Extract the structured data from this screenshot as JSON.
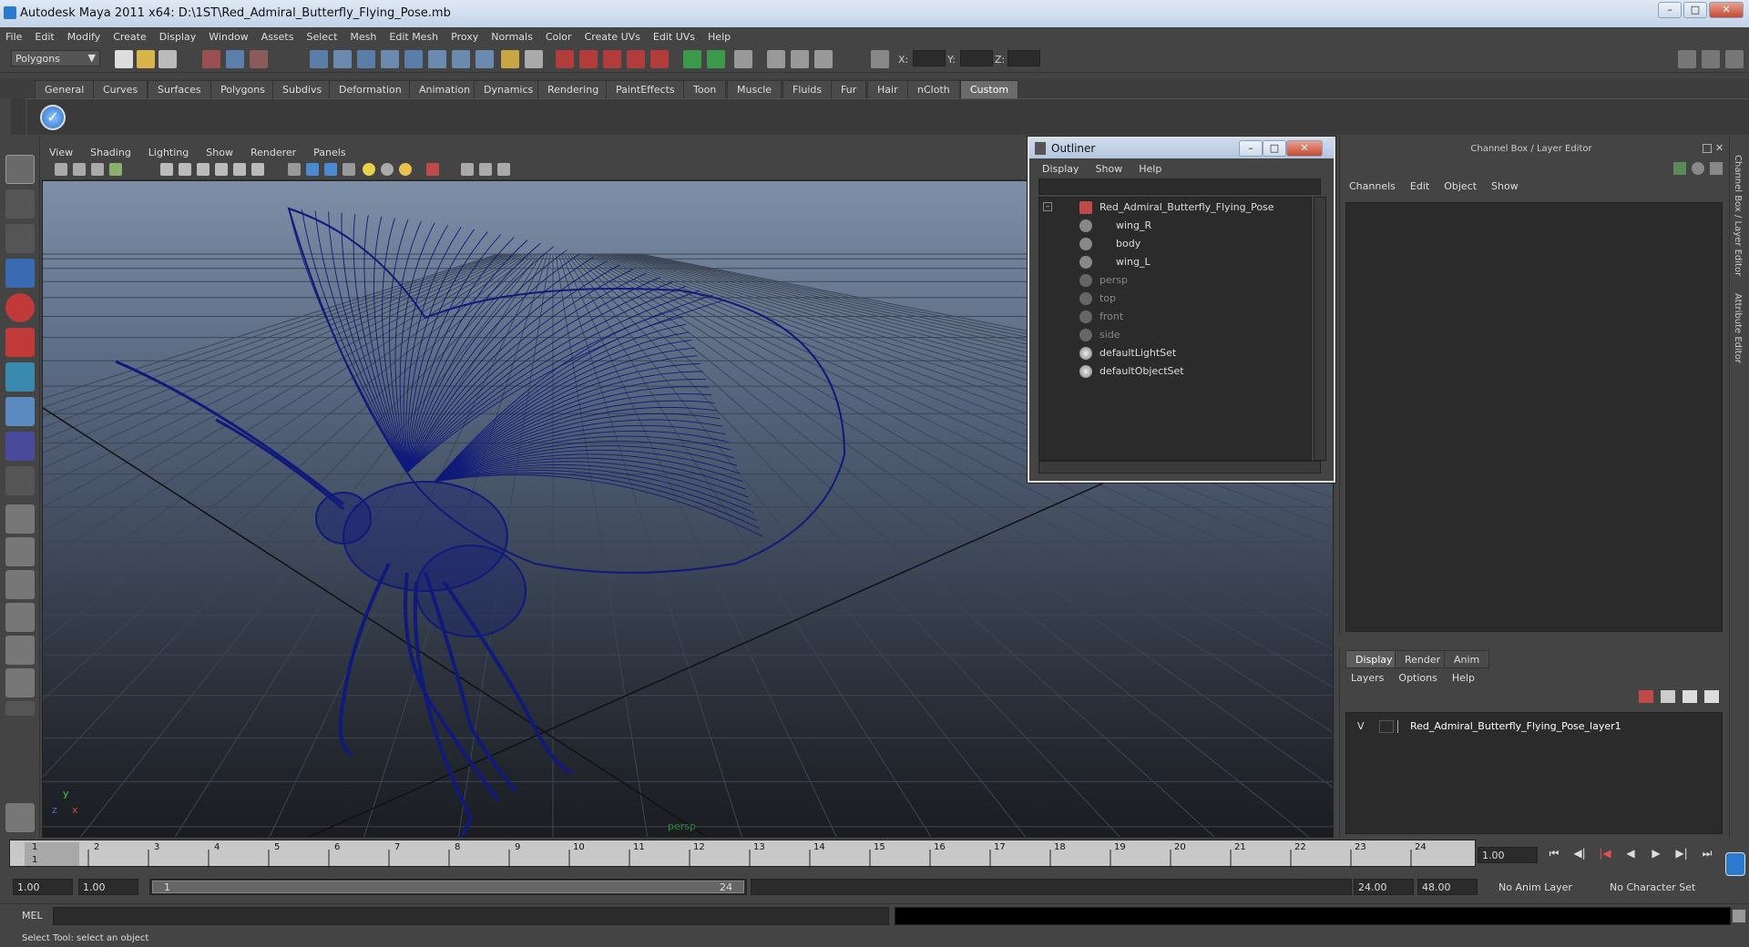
{
  "window": {
    "title": "Autodesk Maya 2011 x64: D:\\1ST\\Red_Admiral_Butterfly_Flying_Pose.mb"
  },
  "menubar": {
    "items": [
      "File",
      "Edit",
      "Modify",
      "Create",
      "Display",
      "Window",
      "Assets",
      "Select",
      "Mesh",
      "Edit Mesh",
      "Proxy",
      "Normals",
      "Color",
      "Create UVs",
      "Edit UVs",
      "Help"
    ]
  },
  "toolbar": {
    "mode_dropdown": "Polygons",
    "x_label": "X:",
    "y_label": "Y:",
    "z_label": "Z:"
  },
  "shelf": {
    "tabs": [
      "General",
      "Curves",
      "Surfaces",
      "Polygons",
      "Subdivs",
      "Deformation",
      "Animation",
      "Dynamics",
      "Rendering",
      "PaintEffects",
      "Toon",
      "Muscle",
      "Fluids",
      "Fur",
      "Hair",
      "nCloth",
      "Custom"
    ],
    "active_tab": "Custom"
  },
  "viewport": {
    "menu": [
      "View",
      "Shading",
      "Lighting",
      "Show",
      "Renderer",
      "Panels"
    ],
    "camera_label": "persp",
    "axis_y": "y",
    "axis_x": "x",
    "axis_z": "z",
    "wire_color": "#101a7a"
  },
  "outliner": {
    "title": "Outliner",
    "menu": [
      "Display",
      "Show",
      "Help"
    ],
    "items": [
      {
        "label": "Red_Admiral_Butterfly_Flying_Pose",
        "indent": 0,
        "dim": false
      },
      {
        "label": "wing_R",
        "indent": 1,
        "dim": false
      },
      {
        "label": "body",
        "indent": 1,
        "dim": false
      },
      {
        "label": "wing_L",
        "indent": 1,
        "dim": false
      },
      {
        "label": "persp",
        "indent": 0,
        "dim": true
      },
      {
        "label": "top",
        "indent": 0,
        "dim": true
      },
      {
        "label": "front",
        "indent": 0,
        "dim": true
      },
      {
        "label": "side",
        "indent": 0,
        "dim": true
      },
      {
        "label": "defaultLightSet",
        "indent": 0,
        "dim": false
      },
      {
        "label": "defaultObjectSet",
        "indent": 0,
        "dim": false
      }
    ]
  },
  "channelbox": {
    "title": "Channel Box / Layer Editor",
    "menu": [
      "Channels",
      "Edit",
      "Object",
      "Show"
    ],
    "side_tabs": [
      "Channel Box / Layer Editor",
      "Attribute Editor"
    ]
  },
  "layers": {
    "tabs": [
      "Display",
      "Render",
      "Anim"
    ],
    "active_tab": "Display",
    "menu": [
      "Layers",
      "Options",
      "Help"
    ],
    "layer_name": "Red_Admiral_Butterfly_Flying_Pose_layer1",
    "visibility_flag": "V"
  },
  "timeline": {
    "ticks": [
      "1",
      "2",
      "3",
      "4",
      "5",
      "6",
      "7",
      "8",
      "9",
      "10",
      "11",
      "12",
      "13",
      "14",
      "15",
      "16",
      "17",
      "18",
      "19",
      "20",
      "21",
      "22",
      "23",
      "24"
    ],
    "current_frame_field": "1.00",
    "current_marker": "1"
  },
  "range": {
    "start_time": "1.00",
    "start_playback": "1.00",
    "range_start": "1",
    "range_end": "24",
    "end_playback": "24.00",
    "end_time": "48.00",
    "anim_layer": "No Anim Layer",
    "character_set": "No Character Set"
  },
  "cmdline": {
    "label": "MEL"
  },
  "helpline": {
    "text": "Select Tool: select an object"
  }
}
